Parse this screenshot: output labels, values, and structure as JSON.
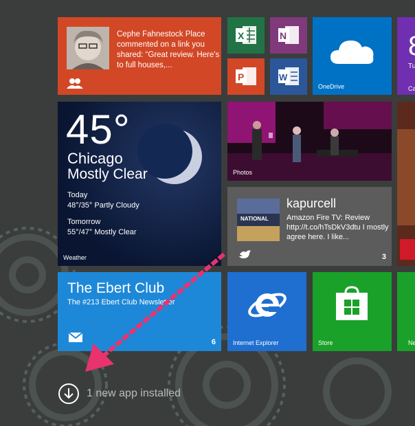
{
  "colors": {
    "people_tile": "#d24726",
    "excel": "#217346",
    "onenote": "#80397b",
    "powerpoint": "#d24726",
    "word": "#2b579a",
    "onedrive": "#0072c6",
    "weather": "#0b1a3c",
    "twitter_tile": "#5a5a5a",
    "ebert_tile": "#1e88d8",
    "ie_tile": "#1f6fd1",
    "store_tile": "#1aa12a",
    "arrow": "#e8336f"
  },
  "people": {
    "message": "Cephe Fahnestock Place commented on a link you shared: “Great review. Here's to full houses,...",
    "icon": "people-icon"
  },
  "apps": {
    "excel_icon": "excel-icon",
    "onenote_icon": "onenote-icon",
    "powerpoint_icon": "powerpoint-icon",
    "word_icon": "word-icon"
  },
  "onedrive": {
    "label": "OneDrive"
  },
  "right_edge": {
    "peek_big": "8",
    "peek_small": "Tu",
    "peek_label": "Ca"
  },
  "weather": {
    "temp": "45°",
    "city": "Chicago",
    "condition": "Mostly Clear",
    "today_label": "Today",
    "today_forecast": "48°/35° Partly Cloudy",
    "tomorrow_label": "Tomorrow",
    "tomorrow_forecast": "55°/47° Mostly Clear",
    "label": "Weather"
  },
  "photos": {
    "label": "Photos"
  },
  "twitter": {
    "username": "kapurcell",
    "tweet": "Amazon Fire TV: Review http://t.co/hTsDkV3dtu I mostly agree here. I like...",
    "thumb_text": "NATIONAL",
    "count": "3"
  },
  "ebert": {
    "title": "The Ebert Club",
    "subtitle": "The #213 Ebert Club Newsletter",
    "count": "6"
  },
  "ie": {
    "label": "Internet Explorer"
  },
  "store": {
    "label": "Store"
  },
  "ne_peek": {
    "label": "Ne"
  },
  "notification": {
    "text": "1 new app installed",
    "icon": "download-circle-icon"
  }
}
